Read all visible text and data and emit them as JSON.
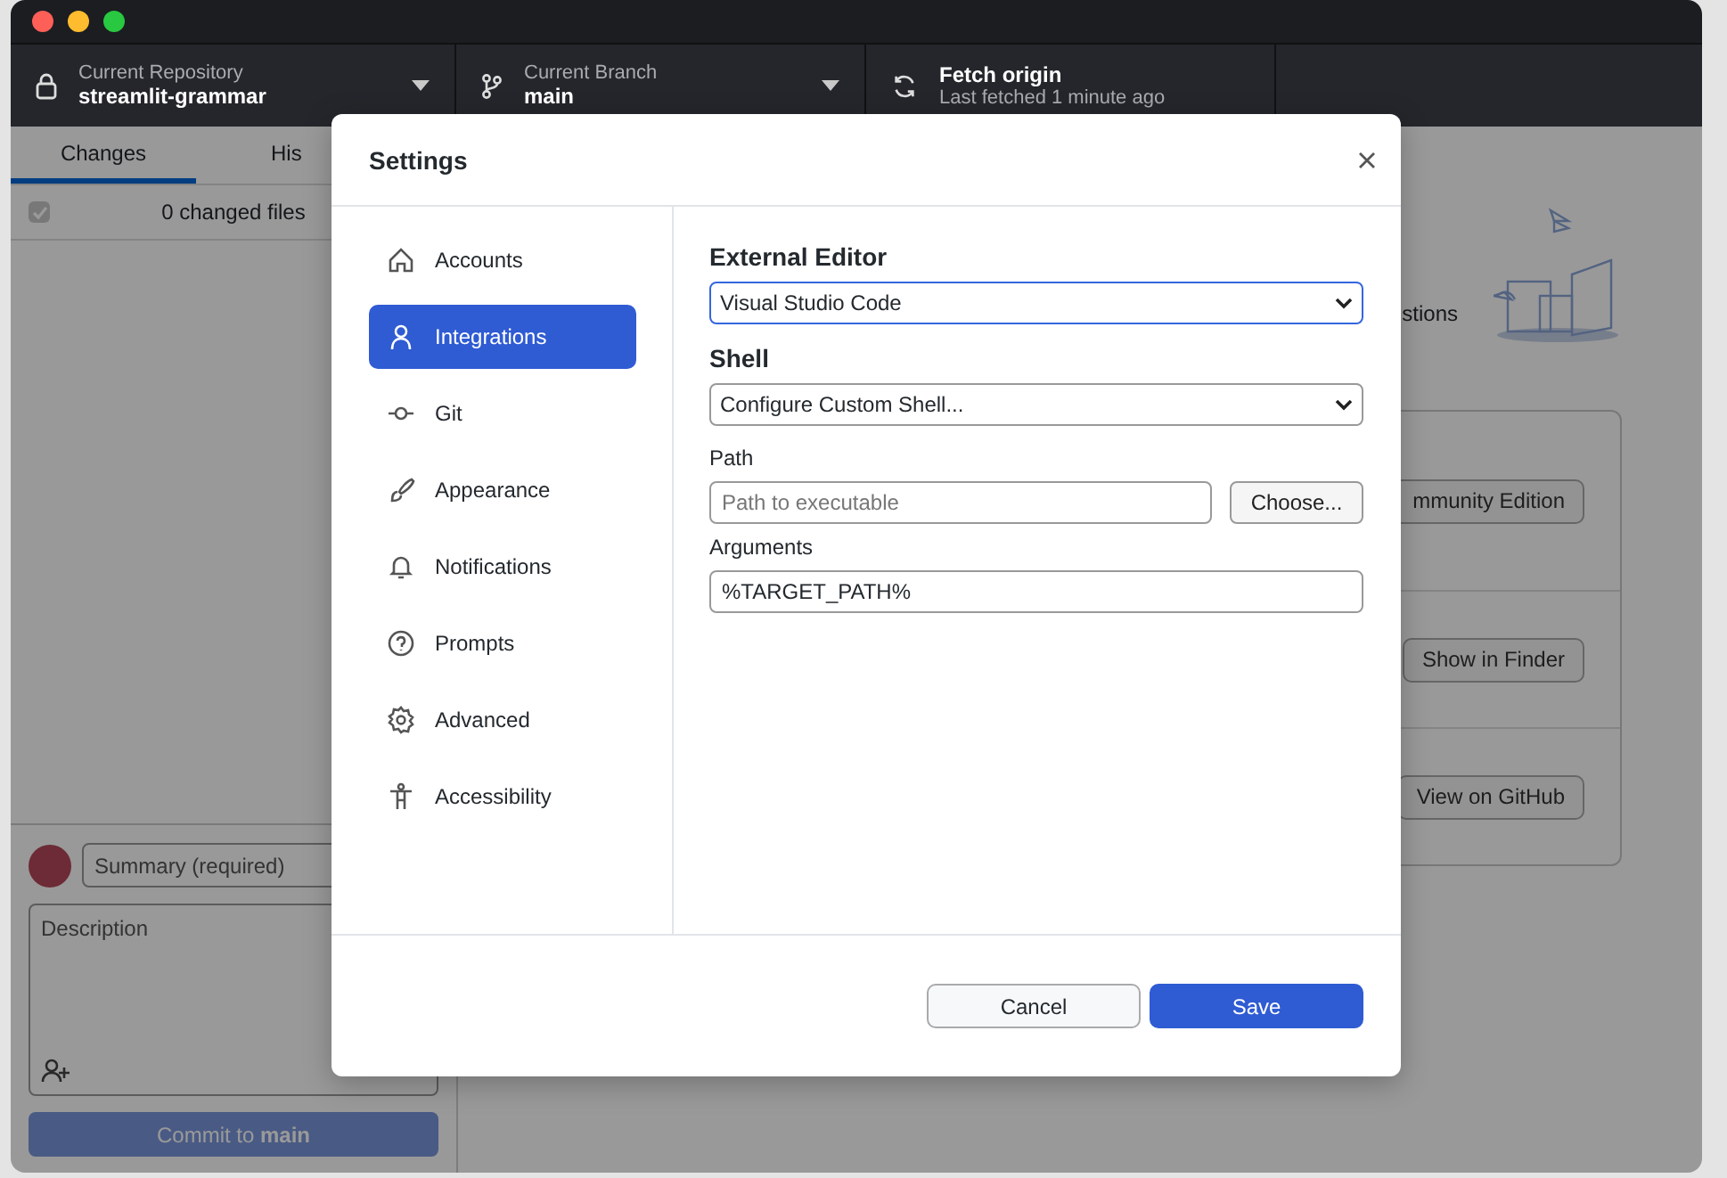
{
  "toolbar": {
    "repository": {
      "label": "Current Repository",
      "value": "streamlit-grammar"
    },
    "branch": {
      "label": "Current Branch",
      "value": "main"
    },
    "fetch": {
      "title": "Fetch origin",
      "subtitle": "Last fetched 1 minute ago"
    }
  },
  "changes_panel": {
    "tabs": [
      {
        "label": "Changes",
        "selected": true
      },
      {
        "label": "His",
        "selected": false
      }
    ],
    "select_all": {
      "checked": true
    },
    "changed_files": "0 changed files",
    "commit": {
      "summary_placeholder": "Summary (required)",
      "description_placeholder": "Description",
      "button": "Commit to **main**"
    }
  },
  "main": {
    "suggestions_text": "stions",
    "actions": [
      {
        "button": "mmunity Edition"
      },
      {
        "button": "Show in Finder"
      },
      {
        "button": "View on GitHub"
      }
    ]
  },
  "settings": {
    "title": "Settings",
    "nav": [
      {
        "label": "Accounts",
        "selected": false
      },
      {
        "label": "Integrations",
        "selected": true
      },
      {
        "label": "Git",
        "selected": false
      },
      {
        "label": "Appearance",
        "selected": false
      },
      {
        "label": "Notifications",
        "selected": false
      },
      {
        "label": "Prompts",
        "selected": false
      },
      {
        "label": "Advanced",
        "selected": false
      },
      {
        "label": "Accessibility",
        "selected": false
      }
    ],
    "external_editor": {
      "label": "External Editor",
      "value": "Visual Studio Code",
      "focused": true
    },
    "shell": {
      "label": "Shell",
      "value": "Configure Custom Shell...",
      "focused": false
    },
    "path": {
      "label": "Path",
      "placeholder": "Path to executable",
      "button": "Choose..."
    },
    "arguments": {
      "label": "Arguments",
      "value": "%TARGET_PATH%"
    },
    "buttons": [
      {
        "label": "Cancel",
        "kind": "secondary"
      },
      {
        "label": "Save",
        "kind": "primary"
      }
    ]
  }
}
